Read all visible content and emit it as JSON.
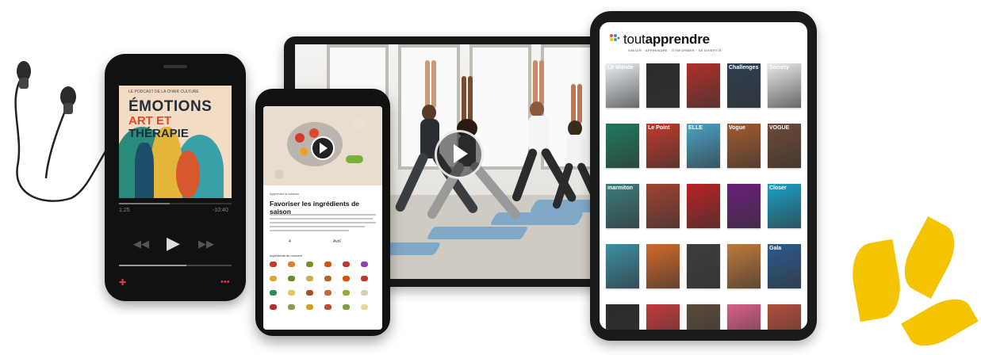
{
  "audio_player": {
    "cover_small_text": "LE PODCAST DE LA CHAIR CULTURE",
    "cover_title_line1": "ÉMOTIONS",
    "cover_title_line2": "ART ET",
    "cover_title_line3": "THÉRAPIE",
    "time_elapsed": "1:25",
    "time_remaining": "-10:40",
    "progress": 0.45,
    "volume": 0.6
  },
  "video_player": {
    "progress": 0
  },
  "recipe_app": {
    "kicker": "Apprendre à cuisiner",
    "title": "Favoriser les ingrédients de saison",
    "quantity": "4",
    "period": "Avril",
    "ingredients_label": "Ingrédients du moment"
  },
  "magazine_app": {
    "brand_prefix": "tout",
    "brand_main": "apprendre",
    "tagline": "SAVOIR · APPRENDRE · S'INFORMER · SE DIVERTIR",
    "magazines": [
      {
        "title": "Le Monde",
        "color": "#e8eef2"
      },
      {
        "title": "",
        "color": "#2b2b2b"
      },
      {
        "title": "",
        "color": "#b0302a"
      },
      {
        "title": "Challenges",
        "color": "#2d3e50"
      },
      {
        "title": "Society",
        "color": "#e9e9e9"
      },
      {
        "title": "",
        "color": "#1f7a5f"
      },
      {
        "title": "Le Point",
        "color": "#c0392b"
      },
      {
        "title": "ELLE",
        "color": "#4aa3c6"
      },
      {
        "title": "Vogue",
        "color": "#a35b2e"
      },
      {
        "title": "VOGUE",
        "color": "#6e4a35"
      },
      {
        "title": "marmiton",
        "color": "#3a7d7c"
      },
      {
        "title": "",
        "color": "#a0432f"
      },
      {
        "title": "",
        "color": "#bb2222"
      },
      {
        "title": "",
        "color": "#6a1f7a"
      },
      {
        "title": "Closer",
        "color": "#1aa0c8"
      },
      {
        "title": "",
        "color": "#3b8fa3"
      },
      {
        "title": "",
        "color": "#d46a2a"
      },
      {
        "title": "",
        "color": "#3d3d3d"
      },
      {
        "title": "",
        "color": "#c07a3a"
      },
      {
        "title": "Gala",
        "color": "#2a5b8f"
      },
      {
        "title": "",
        "color": "#2b2b2b"
      },
      {
        "title": "",
        "color": "#c23b3b"
      },
      {
        "title": "",
        "color": "#5a4a3a"
      },
      {
        "title": "",
        "color": "#d85f8a"
      },
      {
        "title": "",
        "color": "#b44e3a"
      }
    ]
  },
  "colors": {
    "brand_yellow": "#f5c400",
    "accent_red": "#e2334a"
  }
}
